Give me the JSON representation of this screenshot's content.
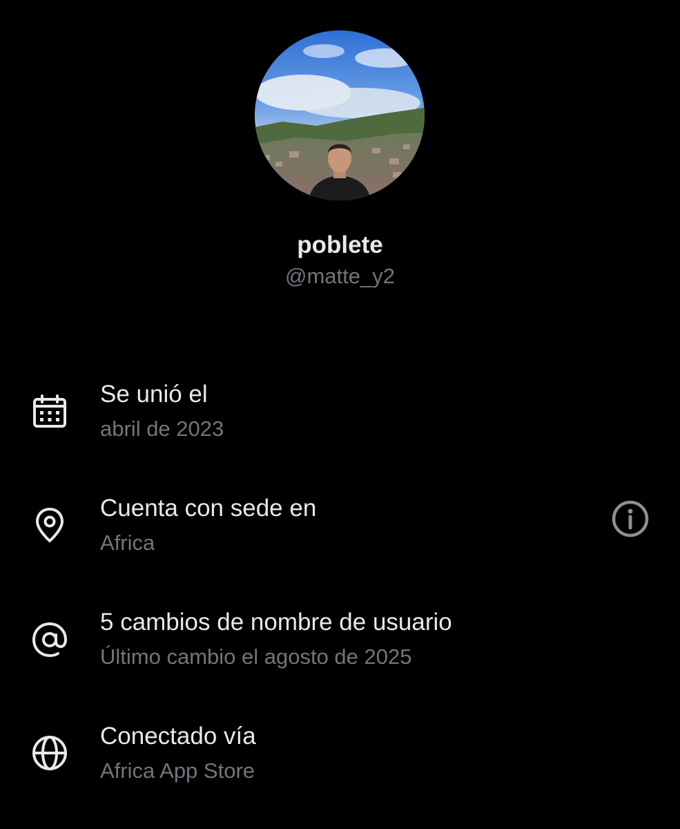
{
  "profile": {
    "display_name": "poblete",
    "handle": "@matte_y2"
  },
  "rows": [
    {
      "icon": "calendar-icon",
      "title": "Se unió el",
      "subtitle": "abril de 2023"
    },
    {
      "icon": "location-pin-icon",
      "title": "Cuenta con sede en",
      "subtitle": "Africa",
      "action_icon": "info-icon"
    },
    {
      "icon": "at-sign-icon",
      "title": "5 cambios de nombre de usuario",
      "subtitle": "Último cambio el agosto de 2025"
    },
    {
      "icon": "globe-icon",
      "title": "Conectado vía",
      "subtitle": "Africa App Store"
    }
  ],
  "colors": {
    "background": "#000000",
    "primary_text": "#e7e9ea",
    "secondary_text": "#71767b",
    "info_icon": "#8b9096"
  }
}
